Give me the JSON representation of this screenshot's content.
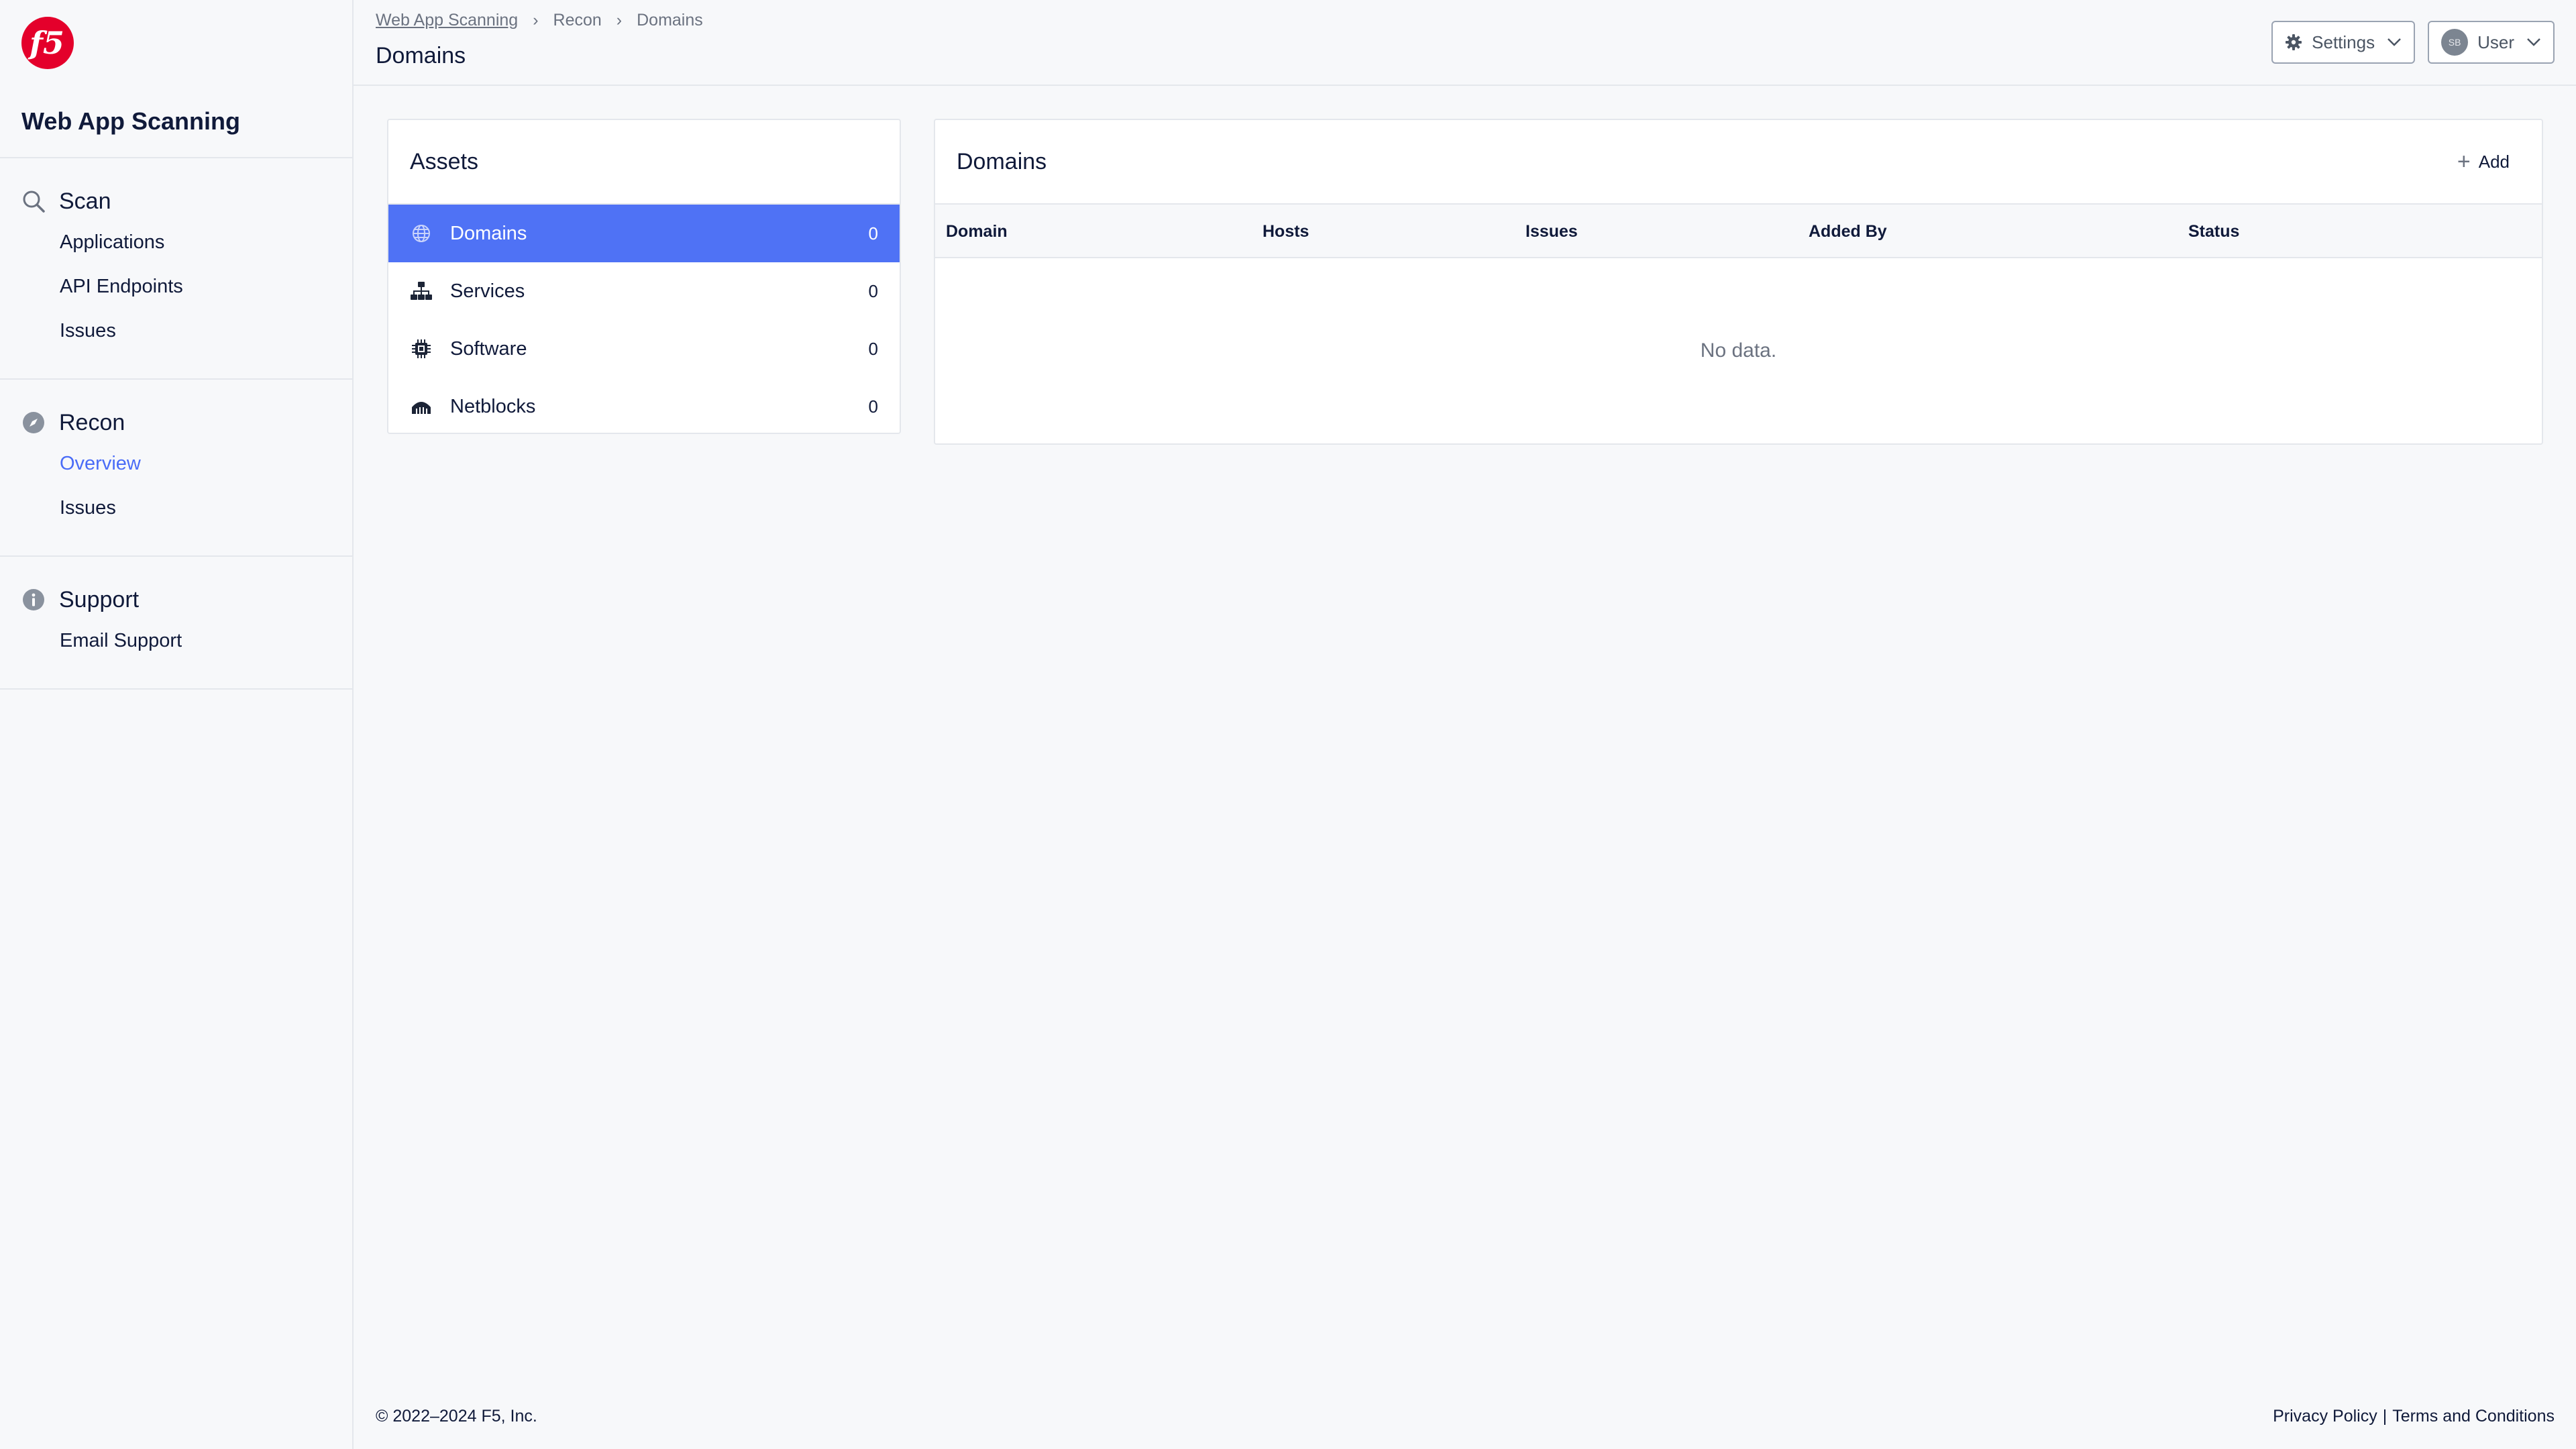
{
  "brand": {
    "logo_text": "f5",
    "logo_color": "#e4002b",
    "accent": "#4f72f5"
  },
  "sidebar": {
    "app_title": "Web App Scanning",
    "sections": [
      {
        "title": "Scan",
        "icon": "search-icon",
        "items": [
          "Applications",
          "API Endpoints",
          "Issues"
        ]
      },
      {
        "title": "Recon",
        "icon": "compass-icon",
        "items": [
          "Overview",
          "Issues"
        ],
        "active_item": "Overview"
      },
      {
        "title": "Support",
        "icon": "info-icon",
        "items": [
          "Email Support"
        ]
      }
    ]
  },
  "header": {
    "breadcrumb": [
      "Web App Scanning",
      "Recon",
      "Domains"
    ],
    "title": "Domains",
    "settings_label": "Settings",
    "user_label": "User",
    "avatar_initials": "SB"
  },
  "assets": {
    "title": "Assets",
    "items": [
      {
        "label": "Domains",
        "count": "0",
        "icon": "globe-icon",
        "active": true
      },
      {
        "label": "Services",
        "count": "0",
        "icon": "network-icon"
      },
      {
        "label": "Software",
        "count": "0",
        "icon": "chip-icon"
      },
      {
        "label": "Netblocks",
        "count": "0",
        "icon": "netblock-icon"
      }
    ]
  },
  "domains": {
    "title": "Domains",
    "add_label": "Add",
    "columns": [
      "Domain",
      "Hosts",
      "Issues",
      "Added By",
      "Status"
    ],
    "empty_text": "No data."
  },
  "footer": {
    "copyright": "© 2022–2024 F5, Inc.",
    "privacy": "Privacy Policy",
    "separator": "|",
    "terms": "Terms and Conditions"
  }
}
